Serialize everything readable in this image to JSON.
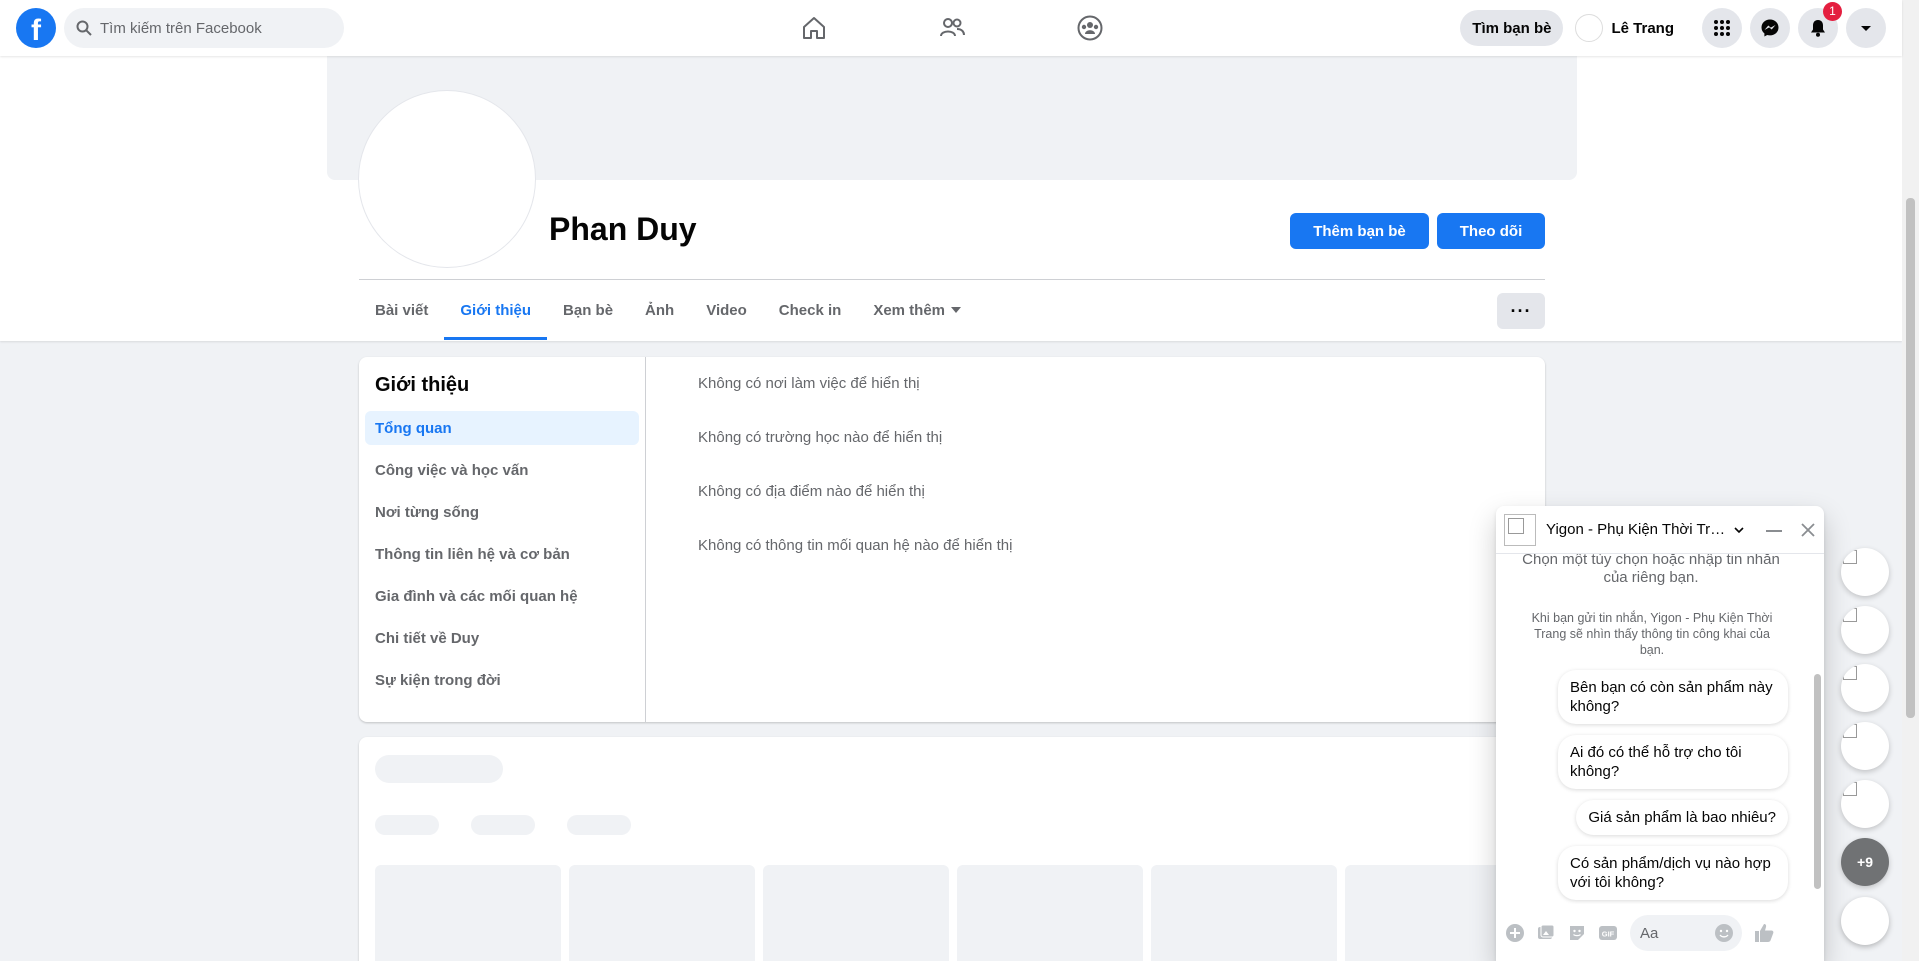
{
  "topbar": {
    "search_placeholder": "Tìm kiếm trên Facebook",
    "find_friends": "Tìm bạn bè",
    "user_name": "Lê Trang",
    "notification_count": "1"
  },
  "profile": {
    "name": "Phan Duy",
    "add_friend": "Thêm bạn bè",
    "follow": "Theo dõi",
    "more": "···",
    "tabs": [
      "Bài viết",
      "Giới thiệu",
      "Bạn bè",
      "Ảnh",
      "Video",
      "Check in",
      "Xem thêm"
    ]
  },
  "about": {
    "title": "Giới thiệu",
    "menu": [
      "Tổng quan",
      "Công việc và học vấn",
      "Nơi từng sống",
      "Thông tin liên hệ và cơ bản",
      "Gia đình và các mối quan hệ",
      "Chi tiết về Duy",
      "Sự kiện trong đời"
    ],
    "empty": [
      "Không có nơi làm việc để hiển thị",
      "Không có trường học nào để hiển thị",
      "Không có địa điểm nào để hiển thị",
      "Không có thông tin mối quan hệ nào để hiển thị"
    ]
  },
  "chat": {
    "name": "Yigon - Phụ Kiện Thời Trang",
    "hint": "Chọn một tùy chọn hoặc nhập tin nhắn của riêng bạn.",
    "note": "Khi bạn gửi tin nhắn, Yigon - Phụ Kiện Thời Trang sẽ nhìn thấy thông tin công khai của bạn.",
    "quick_replies": [
      "Bên bạn có còn sản phẩm này không?",
      "Ai đó có thể hỗ trợ cho tôi không?",
      "Giá sản phẩm là bao nhiêu?",
      "Có sản phẩm/dịch vụ nào hợp với tôi không?"
    ],
    "input_placeholder": "Aa",
    "gif_label": "GIF"
  },
  "chat_heads": {
    "more_count": "+9"
  },
  "colors": {
    "brand": "#1877f2",
    "badge": "#e41e3f",
    "active_bg": "#e7f3ff"
  }
}
